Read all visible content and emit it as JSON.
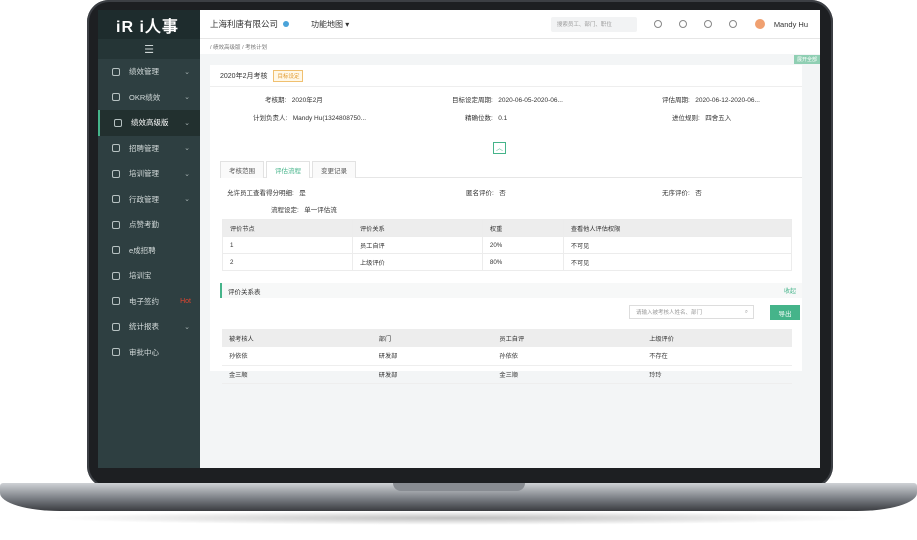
{
  "app": {
    "logo": "iR i人事",
    "company": "上海利唐有限公司",
    "function_map": "功能地图",
    "search_placeholder": "搜索员工、部门、职位",
    "user_name": "Mandy Hu",
    "expand_all": "展开全部"
  },
  "sidebar": {
    "items": [
      {
        "label": "绩效管理",
        "chevron": true
      },
      {
        "label": "OKR绩效",
        "chevron": true
      },
      {
        "label": "绩效高级版",
        "chevron": true,
        "active": true
      },
      {
        "label": "招聘管理",
        "chevron": true
      },
      {
        "label": "培训管理",
        "chevron": true
      },
      {
        "label": "行政管理",
        "chevron": true
      },
      {
        "label": "点赞考勤"
      },
      {
        "label": "e成招聘"
      },
      {
        "label": "培训宝"
      },
      {
        "label": "电子签约",
        "hot": "Hot"
      },
      {
        "label": "统计报表",
        "chevron": true
      },
      {
        "label": "审批中心"
      }
    ]
  },
  "breadcrumb": "/ 绩效高级版 / 考核计划",
  "plan": {
    "title": "2020年2月考核",
    "badge": "目标设定"
  },
  "fields": {
    "period_label": "考核期:",
    "period": "2020年2月",
    "goal_period_label": "目标设定周期:",
    "goal_period": "2020-06-05-2020-06...",
    "eval_period_label": "评估周期:",
    "eval_period": "2020-06-12-2020-06...",
    "owner_label": "计划负责人:",
    "owner": "Mandy Hu(1324808750...",
    "precision_label": "精确位数:",
    "precision": "0.1",
    "rounding_label": "进位规则:",
    "rounding": "四舍五入"
  },
  "tabs": [
    "考核范围",
    "评估流程",
    "变更记录"
  ],
  "flow": {
    "allow_view_label": "允许员工查看得分明细:",
    "allow_view": "是",
    "anon_label": "匿名评价:",
    "anon": "否",
    "unordered_label": "无序评价:",
    "unordered": "否",
    "flow_set_label": "流程设定:",
    "flow_set": "单一评估流"
  },
  "table1": {
    "headers": [
      "评价节点",
      "评价关系",
      "权重",
      "查看他人评估权限"
    ],
    "rows": [
      [
        "1",
        "员工自评",
        "20%",
        "不可见"
      ],
      [
        "2",
        "上级评价",
        "80%",
        "不可见"
      ]
    ]
  },
  "relations": {
    "title": "评价关系表",
    "collapse": "收起",
    "search_placeholder": "请输入被考核人姓名、部门",
    "export": "导出"
  },
  "table2": {
    "headers": [
      "被考核人",
      "部门",
      "员工自评",
      "上级评价"
    ],
    "rows": [
      [
        "孙依依",
        "研发部",
        "孙依依",
        "不存在"
      ],
      [
        "金三顺",
        "研发部",
        "金三顺",
        "玲玲"
      ]
    ]
  }
}
